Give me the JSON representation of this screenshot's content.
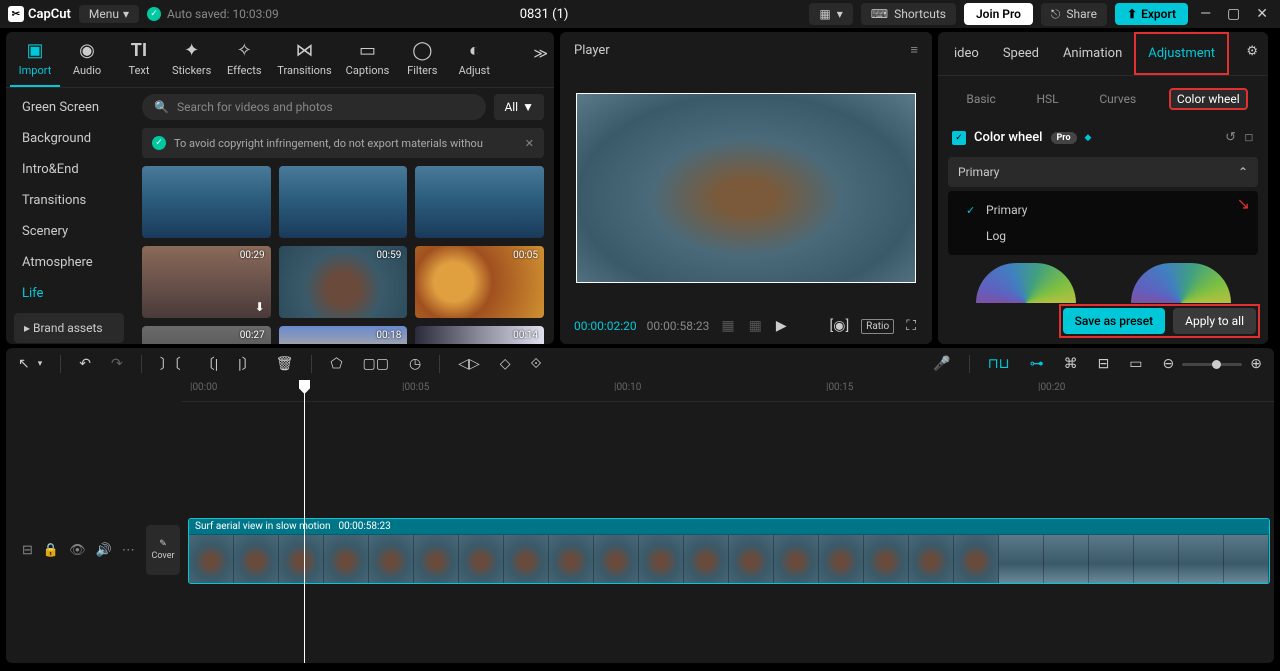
{
  "app": {
    "name": "CapCut",
    "menu": "Menu",
    "auto_saved": "Auto saved: 10:03:09",
    "project_title": "0831 (1)"
  },
  "titlebar": {
    "shortcuts": "Shortcuts",
    "join_pro": "Join Pro",
    "share": "Share",
    "export": "Export"
  },
  "media_tabs": {
    "import": "Import",
    "audio": "Audio",
    "text": "Text",
    "stickers": "Stickers",
    "effects": "Effects",
    "transitions": "Transitions",
    "captions": "Captions",
    "filters": "Filters",
    "adjust": "Adjust"
  },
  "categories": [
    "Green Screen",
    "Background",
    "Intro&End",
    "Transitions",
    "Scenery",
    "Atmosphere",
    "Life"
  ],
  "brand_assets": "Brand assets",
  "search": {
    "placeholder": "Search for videos and photos",
    "all": "All"
  },
  "warning": "To avoid copyright infringement, do not export materials withou",
  "thumbs": [
    {
      "dur": "",
      "cls": "th-ocean"
    },
    {
      "dur": "",
      "cls": "th-ocean"
    },
    {
      "dur": "",
      "cls": "th-ocean"
    },
    {
      "dur": "00:29",
      "cls": "th-run",
      "dl": true
    },
    {
      "dur": "00:59",
      "cls": "th-rock"
    },
    {
      "dur": "00:05",
      "cls": "th-burger"
    },
    {
      "dur": "00:27",
      "cls": "th-crowd"
    },
    {
      "dur": "00:18",
      "cls": "th-sunset"
    },
    {
      "dur": "00:14",
      "cls": "th-man"
    }
  ],
  "player": {
    "title": "Player",
    "current": "00:00:02:20",
    "total": "00:00:58:23",
    "ratio": "Ratio"
  },
  "adjust_tabs": {
    "video": "ideo",
    "speed": "Speed",
    "animation": "Animation",
    "adjustment": "Adjustment"
  },
  "adjust_subtabs": {
    "basic": "Basic",
    "hsl": "HSL",
    "curves": "Curves",
    "color_wheel": "Color wheel"
  },
  "color_wheel": {
    "label": "Color wheel",
    "pro": "Pro",
    "primary": "Primary",
    "options": [
      "Primary",
      "Log"
    ]
  },
  "buttons": {
    "save_preset": "Save as preset",
    "apply_all": "Apply to all"
  },
  "ruler": [
    "00:00",
    "00:05",
    "00:10",
    "00:15",
    "00:20"
  ],
  "clip": {
    "name": "Surf aerial view in slow motion",
    "dur": "00:00:58:23"
  },
  "cover": "Cover"
}
